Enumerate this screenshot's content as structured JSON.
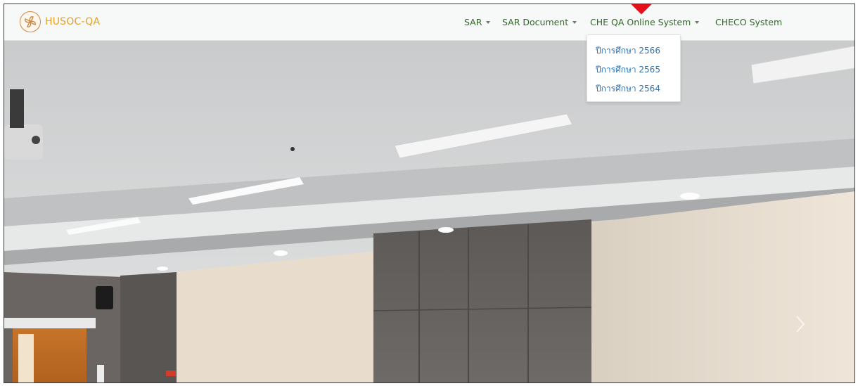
{
  "brand": {
    "name": "HUSOC-QA",
    "logo_icon": "pinwheel-logo-icon"
  },
  "nav": {
    "items": [
      {
        "label": "SAR",
        "has_dropdown": true
      },
      {
        "label": "SAR Document",
        "has_dropdown": true
      },
      {
        "label": "CHE QA Online System",
        "has_dropdown": true
      },
      {
        "label": "CHECO System",
        "has_dropdown": false
      }
    ]
  },
  "dropdown": {
    "parent": "CHE QA Online System",
    "items": [
      {
        "label": "ปีการศึกษา 2566"
      },
      {
        "label": "ปีการศึกษา 2565"
      },
      {
        "label": "ปีการศึกษา 2564"
      }
    ]
  },
  "hero": {
    "description_icon": "meeting-room-photo",
    "next_control_icon": "chevron-right-icon"
  },
  "colors": {
    "brand": "#e5a122",
    "nav_text": "#2f6a24",
    "dropdown_link": "#2e74b5",
    "marker": "#e5101a"
  }
}
